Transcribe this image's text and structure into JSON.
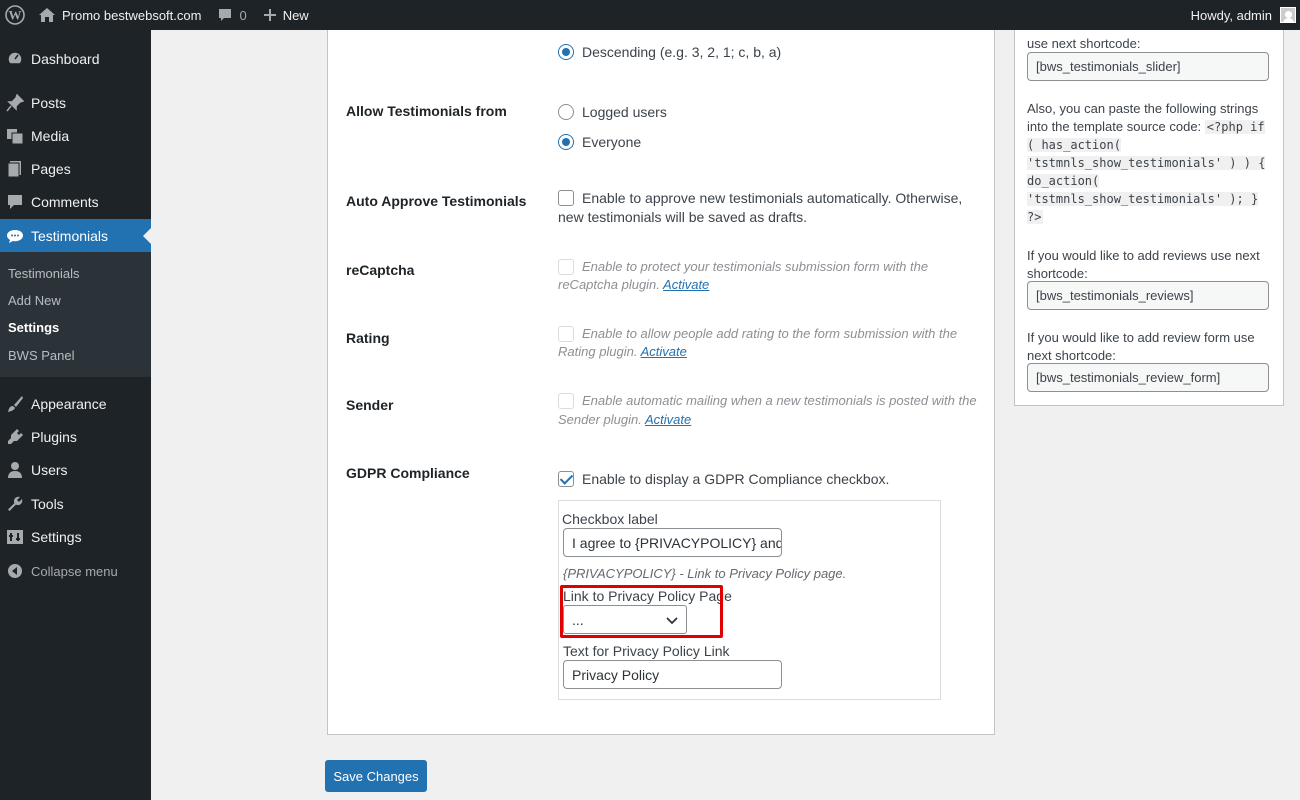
{
  "adminbar": {
    "site_name": "Promo bestwebsoft.com",
    "comments_count": "0",
    "new_label": "New",
    "howdy": "Howdy, admin"
  },
  "sidebar": {
    "items": [
      {
        "label": "Dashboard",
        "icon": "dashboard-icon"
      },
      {
        "label": "Posts",
        "icon": "pin-icon"
      },
      {
        "label": "Media",
        "icon": "media-icon"
      },
      {
        "label": "Pages",
        "icon": "pages-icon"
      },
      {
        "label": "Comments",
        "icon": "comments-icon"
      },
      {
        "label": "Testimonials",
        "icon": "testimonials-icon"
      },
      {
        "label": "Appearance",
        "icon": "brush-icon"
      },
      {
        "label": "Plugins",
        "icon": "plugin-icon"
      },
      {
        "label": "Users",
        "icon": "users-icon"
      },
      {
        "label": "Tools",
        "icon": "wrench-icon"
      },
      {
        "label": "Settings",
        "icon": "settings-icon"
      },
      {
        "label": "Collapse menu",
        "icon": "collapse-icon"
      }
    ],
    "submenu": [
      "Testimonials",
      "Add New",
      "Settings",
      "BWS Panel"
    ]
  },
  "settings": {
    "order_desc_label": "Descending (e.g. 3, 2, 1; c, b, a)",
    "allow_from_label": "Allow Testimonials from",
    "allow_logged": "Logged users",
    "allow_everyone": "Everyone",
    "auto_approve_label": "Auto Approve Testimonials",
    "auto_approve_desc_1": "Enable to approve new testimonials automatically. Otherwise,",
    "auto_approve_desc_2": "new testimonials will be saved as drafts.",
    "recaptcha_label": "reCaptcha",
    "recaptcha_desc_1": "Enable to protect your testimonials submission form with the",
    "recaptcha_desc_2": "reCaptcha plugin.",
    "rating_label": "Rating",
    "rating_desc_1": "Enable to allow people add rating to the form submission with the",
    "rating_desc_2": "Rating plugin.",
    "sender_label": "Sender",
    "sender_desc_1": "Enable automatic mailing when a new testimonials is posted with the",
    "sender_desc_2": "Sender plugin.",
    "activate_link": "Activate",
    "gdpr_label": "GDPR Compliance",
    "gdpr_desc": "Enable to display a GDPR Compliance checkbox.",
    "checkbox_label_title": "Checkbox label",
    "checkbox_label_value": "I agree to {PRIVACYPOLICY} and ha",
    "privacy_hint_token": "{PRIVACYPOLICY}",
    "privacy_hint_text": " - Link to Privacy Policy page.",
    "privacy_page_title": "Link to Privacy Policy Page",
    "privacy_page_value": "...",
    "privacy_text_title": "Text for Privacy Policy Link",
    "privacy_text_value": "Privacy Policy",
    "save_button": "Save Changes"
  },
  "sidebox": {
    "slider_intro": "use next shortcode:",
    "slider_code": "[bws_testimonials_slider]",
    "template_intro": "Also, you can paste the following strings into the template source code:",
    "template_code": "<?php if ( has_action( 'tstmnls_show_testimonials' ) ) { do_action( 'tstmnls_show_testimonials' ); } ?>",
    "reviews_intro": "If you would like to add reviews use next shortcode:",
    "reviews_code": "[bws_testimonials_reviews]",
    "form_intro": "If you would like to add review form use next shortcode:",
    "form_code": "[bws_testimonials_review_form]"
  }
}
